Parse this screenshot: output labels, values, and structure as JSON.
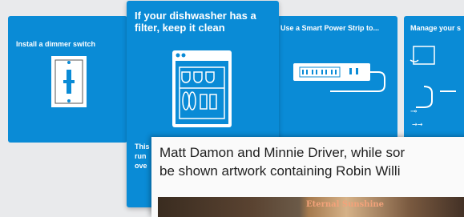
{
  "cards": [
    {
      "title": "Install a dimmer switch",
      "icon": "dimmer-switch-icon"
    },
    {
      "title": "If your dishwasher has a filter, keep it clean",
      "overflow_text": "This\nrun\nove",
      "icon": "dishwasher-icon"
    },
    {
      "title": "Use a Smart Power Strip to...",
      "icon": "power-strip-icon"
    },
    {
      "title": "Manage your s",
      "icon": "laptop-charger-icon"
    }
  ],
  "popup": {
    "text_line1": "Matt Damon and Minnie Driver, while sor",
    "text_line2": "be shown artwork containing Robin Willi",
    "image_caption": "Eternal Sunshine"
  },
  "colors": {
    "card_blue": "#0a8bd6",
    "background": "#e9eaec"
  }
}
